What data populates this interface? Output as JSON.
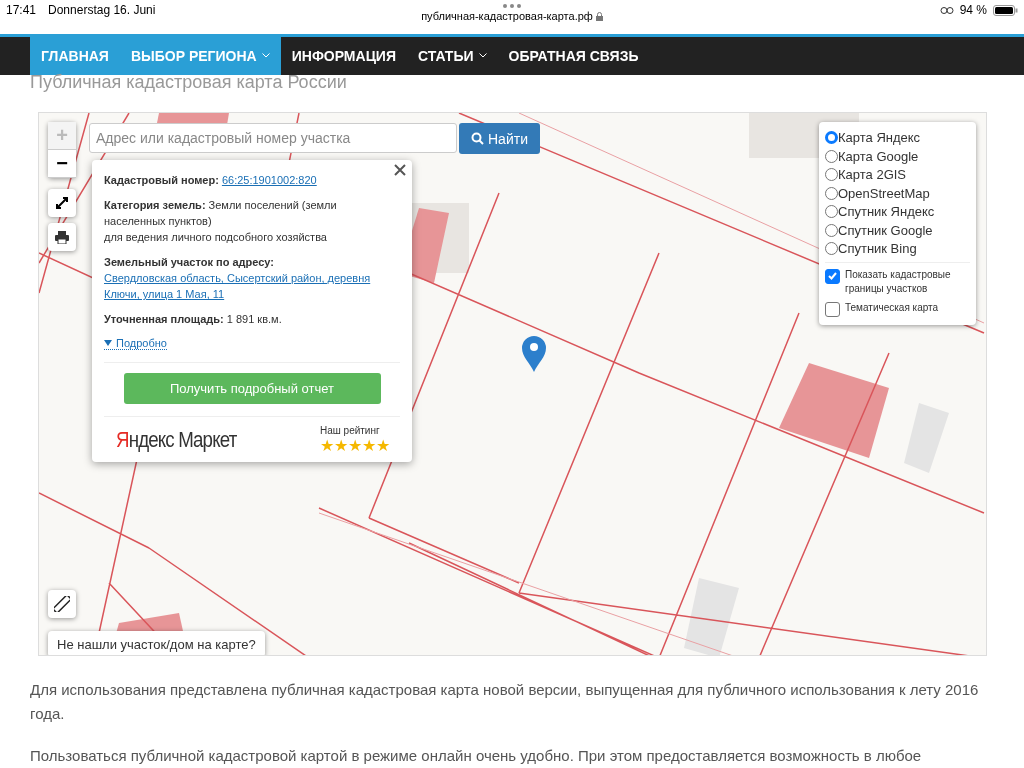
{
  "status_bar": {
    "time": "17:41",
    "date": "Donnerstag 16. Juni",
    "url": "публичная-кадастровая-карта.рф",
    "battery": "94 %"
  },
  "nav": [
    {
      "label": "ГЛАВНАЯ",
      "active": true,
      "dropdown": false
    },
    {
      "label": "ВЫБОР РЕГИОНА",
      "active": true,
      "dropdown": true
    },
    {
      "label": "ИНФОРМАЦИЯ",
      "active": false,
      "dropdown": false
    },
    {
      "label": "СТАТЬИ",
      "active": false,
      "dropdown": true
    },
    {
      "label": "ОБРАТНАЯ СВЯЗЬ",
      "active": false,
      "dropdown": false
    }
  ],
  "page_title": "Публичная кадастровая карта России",
  "map": {
    "search": {
      "placeholder": "Адрес или кадастровый номер участка",
      "button": "Найти"
    },
    "zoom": {
      "plus": "+",
      "minus": "−",
      "plus_disabled": true
    },
    "popup": {
      "fields": [
        {
          "kind": "link",
          "label": "Кадастровый номер:",
          "value": "66:25:1901002:820"
        },
        {
          "kind": "text",
          "label": "Категория земель:",
          "value": "Земли поселений (земли населенных пунктов)",
          "note": "для ведения личного подсобного хозяйства"
        },
        {
          "kind": "block_link",
          "label": "Земельный участок по адресу:",
          "value": "Свердловская область, Сысертский район, деревня Ключи, улица 1 Мая, 11"
        },
        {
          "kind": "text",
          "label": "Уточненная площадь:",
          "value": "1 891 кв.м."
        }
      ],
      "more": "Подробно",
      "report_button": "Получить подробный отчет",
      "logo": "Яндекс Маркет",
      "rating_label": "Наш рейтинг",
      "stars": 5
    },
    "layers": [
      {
        "label": "Карта Яндекс",
        "selected": true
      },
      {
        "label": "Карта Google",
        "selected": false
      },
      {
        "label": "Карта 2GIS",
        "selected": false
      },
      {
        "label": "OpenStreetMap",
        "selected": false
      },
      {
        "label": "Спутник Яндекс",
        "selected": false
      },
      {
        "label": "Спутник Google",
        "selected": false
      },
      {
        "label": "Спутник Bing",
        "selected": false
      }
    ],
    "options": [
      {
        "label": "Показать кадастровые границы участков",
        "checked": true
      },
      {
        "label": "Тематическая карта",
        "checked": false
      }
    ],
    "not_found_button": "Не нашли участок/дом на карте?"
  },
  "paragraphs": [
    "Для использования представлена публичная кадастровая карта новой версии, выпущенная для публичного использования к лету 2016 года.",
    "Пользоваться публичной кадастровой картой в режиме онлайн очень удобно. При этом предоставляется возможность в любое"
  ]
}
